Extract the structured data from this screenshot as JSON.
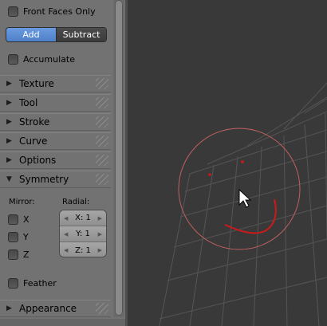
{
  "panel": {
    "front_faces_only": "Front Faces Only",
    "mode_add": "Add",
    "mode_subtract": "Subtract",
    "accumulate": "Accumulate",
    "sections": {
      "texture": "Texture",
      "tool": "Tool",
      "stroke": "Stroke",
      "curve": "Curve",
      "options": "Options",
      "symmetry": "Symmetry",
      "appearance": "Appearance"
    },
    "symmetry": {
      "mirror_label": "Mirror:",
      "radial_label": "Radial:",
      "mirror_x": "X",
      "mirror_y": "Y",
      "mirror_z": "Z",
      "radial_x": "X: 1",
      "radial_y": "Y: 1",
      "radial_z": "Z: 1",
      "feather": "Feather"
    }
  },
  "colors": {
    "panel_bg": "#727272",
    "viewport_bg": "#393939",
    "active_button": "#5a8ad4",
    "brush_circle": "#c06060",
    "stroke_red": "#cc1a1a"
  },
  "icons": {
    "expanded": "triangle-down",
    "collapsed": "triangle-right",
    "cursor": "arrow-pointer"
  }
}
